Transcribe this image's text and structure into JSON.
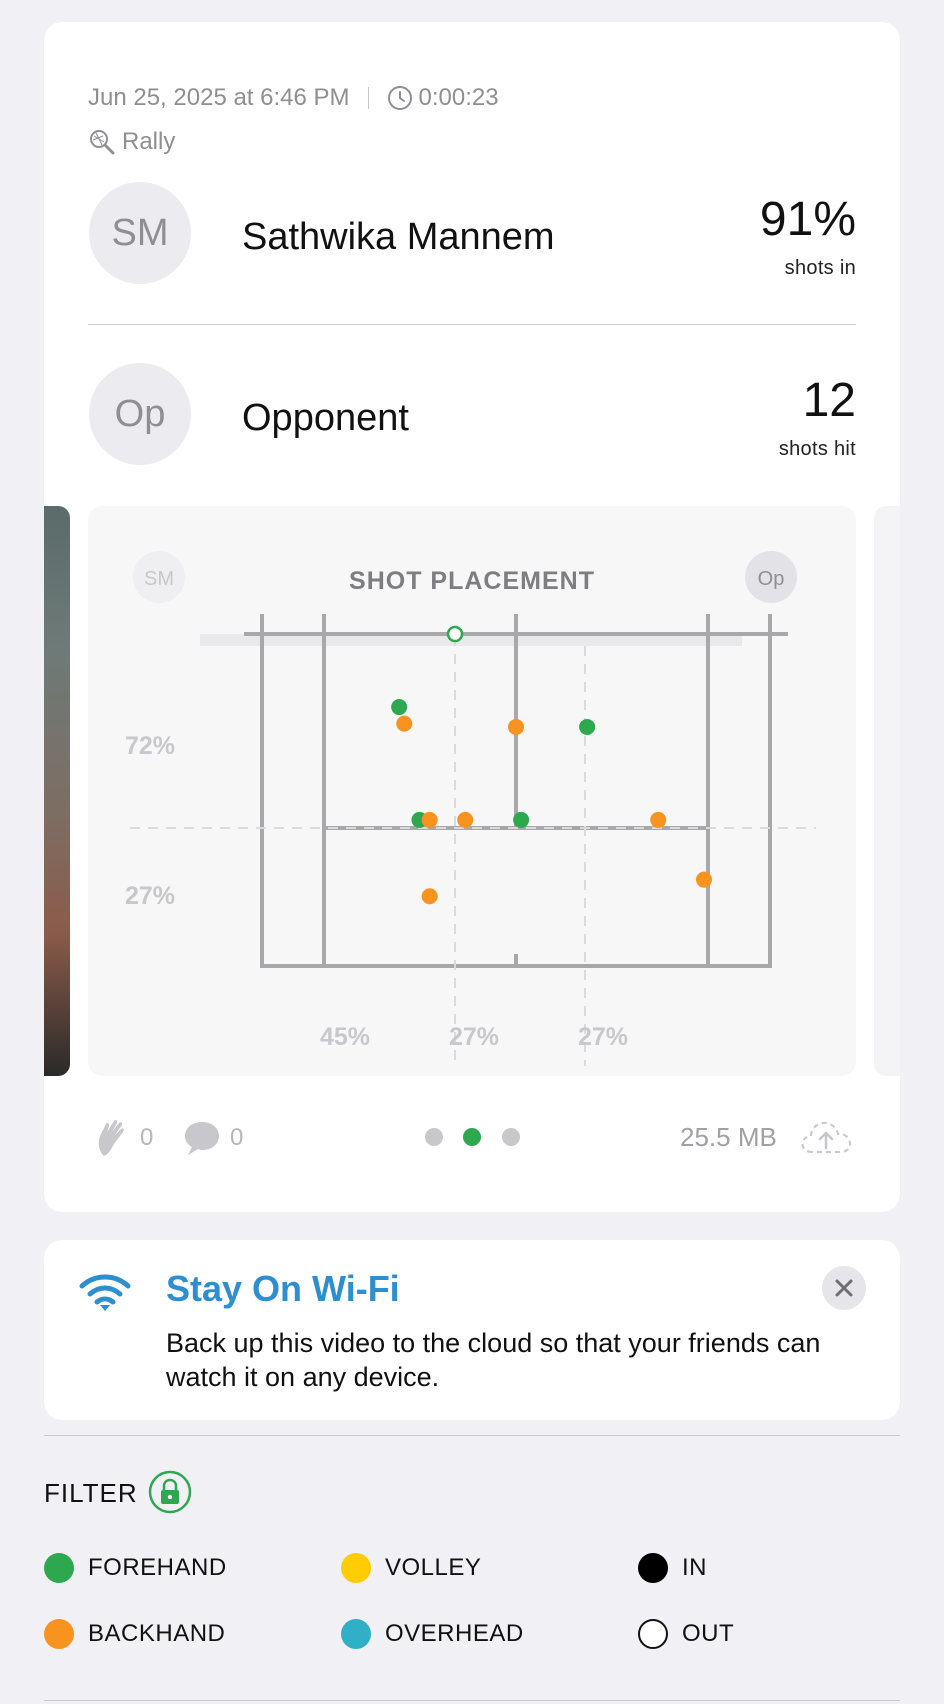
{
  "session": {
    "date_time": "Jun 25, 2025 at 6:46 PM",
    "duration": "0:00:23",
    "mode": "Rally"
  },
  "player": {
    "initials": "SM",
    "name": "Sathwika Mannem",
    "stat_value": "91%",
    "stat_label": "shots in"
  },
  "opponent": {
    "initials": "Op",
    "name": "Opponent",
    "stat_value": "12",
    "stat_label": "shots hit"
  },
  "chart_data": {
    "type": "scatter",
    "title": "SHOT PLACEMENT",
    "left_badge": "SM",
    "right_badge": "Op",
    "row_percentages": [
      "72%",
      "27%"
    ],
    "column_percentages": [
      "45%",
      "27%",
      "27%"
    ],
    "x_range": [
      0,
      1
    ],
    "y_range": [
      0,
      1
    ],
    "axes": "relative court position: x 0 = left sideline to 1 = right sideline; y 0 = net to 1 = baseline",
    "series": [
      {
        "name": "FOREHAND",
        "color": "#2ea84f",
        "points": [
          [
            0.27,
            0.22
          ],
          [
            0.31,
            0.56
          ],
          [
            0.51,
            0.56
          ],
          [
            0.64,
            0.28
          ]
        ]
      },
      {
        "name": "BACKHAND",
        "color": "#f7931e",
        "points": [
          [
            0.28,
            0.27
          ],
          [
            0.33,
            0.56
          ],
          [
            0.4,
            0.56
          ],
          [
            0.5,
            0.28
          ],
          [
            0.78,
            0.56
          ],
          [
            0.87,
            0.74
          ],
          [
            0.33,
            0.79
          ]
        ]
      },
      {
        "name": "IN",
        "color": "#2ea84f",
        "hollow": true,
        "points": [
          [
            0.38,
            0.0
          ]
        ]
      }
    ]
  },
  "footer": {
    "claps_count": "0",
    "comments_count": "0",
    "file_size": "25.5 MB",
    "page_count": 3,
    "active_page": 1
  },
  "wifi_banner": {
    "title": "Stay On Wi-Fi",
    "body": "Back up this video to the cloud so that your friends can watch it on any device."
  },
  "filter": {
    "label": "FILTER",
    "items": [
      {
        "label": "FOREHAND",
        "color": "#2ea84f"
      },
      {
        "label": "VOLLEY",
        "color": "#ffcc00"
      },
      {
        "label": "IN",
        "color": "#000000"
      },
      {
        "label": "BACKHAND",
        "color": "#f7931e"
      },
      {
        "label": "OVERHEAD",
        "color": "#30b0c7"
      },
      {
        "label": "OUT",
        "color": "#ffffff"
      }
    ]
  }
}
